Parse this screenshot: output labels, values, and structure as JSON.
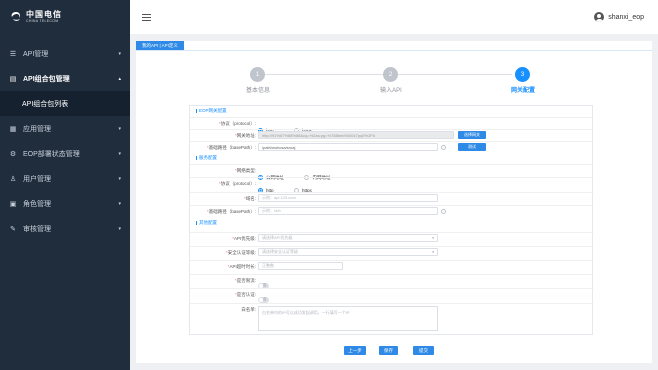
{
  "brand": {
    "name_cn": "中国电信",
    "name_en": "CHINA TELECOM"
  },
  "sidebar": {
    "items": [
      {
        "label": "API管理",
        "icon": "api-icon"
      },
      {
        "label": "API组合包管理",
        "icon": "package-icon",
        "expanded": true
      },
      {
        "label": "API组合包列表",
        "sub": true
      },
      {
        "label": "应用管理",
        "icon": "app-icon"
      },
      {
        "label": "EOP部署状态管理",
        "icon": "settings-icon"
      },
      {
        "label": "用户管理",
        "icon": "user-icon"
      },
      {
        "label": "角色管理",
        "icon": "role-icon"
      },
      {
        "label": "审核管理",
        "icon": "audit-icon"
      }
    ]
  },
  "header": {
    "username": "shanxi_eop"
  },
  "panel": {
    "tab_label": "我的API | API定义"
  },
  "steps": [
    {
      "num": "1",
      "label": "基本信息"
    },
    {
      "num": "2",
      "label": "输入API"
    },
    {
      "num": "3",
      "label": "网关配置",
      "active": true
    }
  ],
  "form": {
    "sections": {
      "gateway": "EOP网关配置",
      "service": "服务配置",
      "other": "其他配置"
    },
    "protocol": {
      "label": "协议（protocol）:",
      "options": [
        "http",
        "https"
      ],
      "selected": "http"
    },
    "api_addr": {
      "label": "网关地址:",
      "value": "http://91%67%88%88&cq=%2as:pg=%788beb900047pq0%2F6",
      "button": "选择网关"
    },
    "base_path": {
      "label": "基础路径（basePath）:",
      "value": "/path/wohcsa/sruaj",
      "button": "测试"
    },
    "network_type": {
      "label": "网络类型:",
      "options": [
        "公网地址",
        "内网地址"
      ],
      "selected": "公网地址"
    },
    "service_protocol": {
      "label": "协议（protocol）:",
      "options": [
        "http",
        "https"
      ],
      "selected": "http"
    },
    "domain": {
      "label": "域名:",
      "placeholder": "示例：api.123.com"
    },
    "service_base_path": {
      "label": "基础路径（basePath）:",
      "placeholder": "示例：/a/b"
    },
    "api_priority": {
      "label": "API优先级:",
      "placeholder": "请选择API优先级"
    },
    "auth_level": {
      "label": "安全认证等级:",
      "placeholder": "请选择安全认证等级"
    },
    "timeout": {
      "label": "API超时时长:",
      "placeholder": "正整数"
    },
    "rate_limit": {
      "label": "是否限流:",
      "state": "否"
    },
    "auth_required": {
      "label": "是否认证:",
      "state": "否"
    },
    "whitelist": {
      "label": "白名单:",
      "placeholder": "白名单内的IP可以成功发起调用，一行填写一个IP"
    }
  },
  "footer": {
    "prev": "上一步",
    "save": "保存",
    "submit": "提交"
  },
  "colors": {
    "primary": "#1890ff",
    "sidebar_bg": "#1f2d3d"
  }
}
